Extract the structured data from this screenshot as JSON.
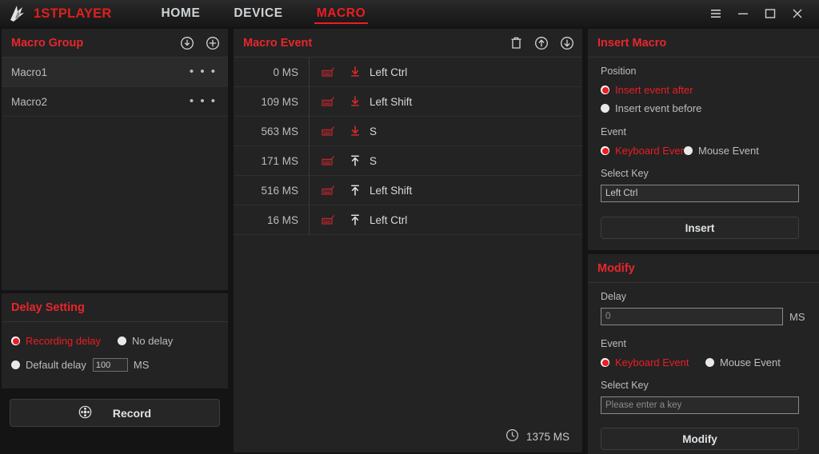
{
  "titlebar": {
    "brand": "1STPLAYER",
    "logo_icon": "lightning-bolt-logo",
    "nav": [
      {
        "label": "HOME",
        "active": false
      },
      {
        "label": "DEVICE",
        "active": false
      },
      {
        "label": "MACRO",
        "active": true
      }
    ],
    "controls": [
      {
        "name": "menu-icon",
        "glyph": "≡"
      },
      {
        "name": "minimize-icon",
        "glyph": "—"
      },
      {
        "name": "maximize-icon",
        "glyph": "□"
      },
      {
        "name": "close-icon",
        "glyph": "✕"
      }
    ]
  },
  "macro_group": {
    "title": "Macro Group",
    "icons": [
      {
        "name": "download-circle-icon"
      },
      {
        "name": "add-circle-icon"
      }
    ],
    "items": [
      {
        "label": "Macro1",
        "selected": true,
        "menu": "• • •"
      },
      {
        "label": "Macro2",
        "selected": false,
        "menu": "• • •"
      }
    ]
  },
  "delay_setting": {
    "title": "Delay Setting",
    "recording_delay": "Recording delay",
    "no_delay": "No delay",
    "default_delay": "Default delay",
    "default_delay_value": "100",
    "unit": "MS",
    "selected": "recording_delay"
  },
  "record": {
    "label": "Record",
    "icon": "record-reel-icon"
  },
  "macro_event": {
    "title": "Macro Event",
    "icons": [
      {
        "name": "delete-icon"
      },
      {
        "name": "move-up-icon"
      },
      {
        "name": "move-down-icon"
      }
    ],
    "rows": [
      {
        "time": "0 MS",
        "device": "keyboard",
        "direction": "down",
        "key": "Left Ctrl"
      },
      {
        "time": "109 MS",
        "device": "keyboard",
        "direction": "down",
        "key": "Left Shift"
      },
      {
        "time": "563 MS",
        "device": "keyboard",
        "direction": "down",
        "key": "S"
      },
      {
        "time": "171 MS",
        "device": "keyboard",
        "direction": "up",
        "key": "S"
      },
      {
        "time": "516 MS",
        "device": "keyboard",
        "direction": "up",
        "key": "Left Shift"
      },
      {
        "time": "16 MS",
        "device": "keyboard",
        "direction": "up",
        "key": "Left Ctrl"
      }
    ],
    "total_time": "1375 MS",
    "total_icon": "clock-icon"
  },
  "insert_macro": {
    "title": "Insert Macro",
    "position_label": "Position",
    "position_options": [
      {
        "label": "Insert event after",
        "selected": true
      },
      {
        "label": "Insert event before",
        "selected": false
      }
    ],
    "event_label": "Event",
    "event_options": [
      {
        "label": "Keyboard Event",
        "selected": true
      },
      {
        "label": "Mouse Event",
        "selected": false
      }
    ],
    "select_key_label": "Select Key",
    "select_key_value": "Left Ctrl",
    "button_label": "Insert"
  },
  "modify": {
    "title": "Modify",
    "delay_label": "Delay",
    "delay_placeholder": "0",
    "delay_value": "",
    "unit": "MS",
    "event_label": "Event",
    "event_options": [
      {
        "label": "Keyboard Event",
        "selected": true
      },
      {
        "label": "Mouse Event",
        "selected": false
      }
    ],
    "select_key_label": "Select Key",
    "select_key_placeholder": "Please enter a key",
    "select_key_value": "",
    "button_label": "Modify"
  },
  "colors": {
    "accent_red": "#ec1c24",
    "panel_bg": "#232323",
    "page_bg": "#141414",
    "text": "#b9bdc0"
  }
}
